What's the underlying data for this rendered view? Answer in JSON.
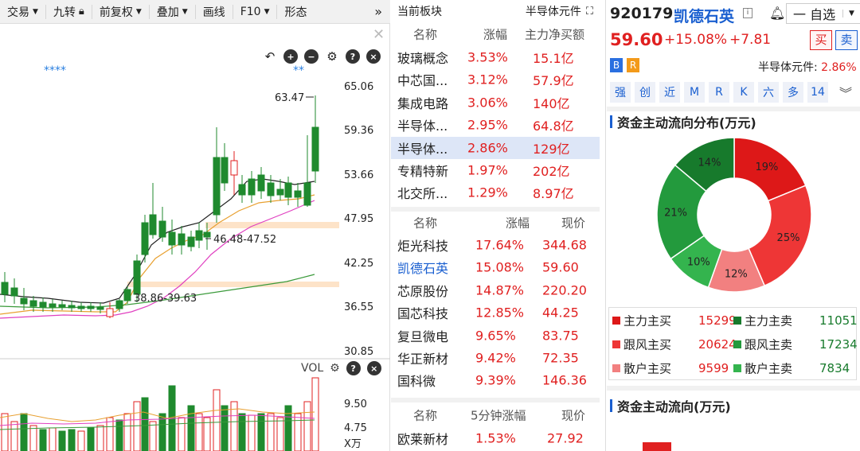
{
  "toolbar": {
    "items": [
      {
        "label": "交易",
        "caret": true
      },
      {
        "label": "九转",
        "icon": "lock-icon"
      },
      {
        "label": "前复权",
        "caret": true
      },
      {
        "label": "叠加",
        "caret": true
      },
      {
        "label": "画线"
      },
      {
        "label": "F10",
        "caret": true
      },
      {
        "label": "形态"
      }
    ]
  },
  "kline": {
    "price_labels": [
      "65.06",
      "59.36",
      "53.66",
      "47.95",
      "42.25",
      "36.55",
      "30.85"
    ],
    "annot_high": "63.47",
    "annot_zone_upper": "46.48-47.52",
    "annot_zone_lower": "38.86-39.63",
    "stars_left": "****",
    "stars_right": "**",
    "vol_label": "VOL",
    "vol_labels": [
      "9.50",
      "4.75",
      "X万"
    ]
  },
  "sector_panel": {
    "title": "当前板块",
    "current": "半导体元件",
    "headers": [
      "名称",
      "涨幅",
      "主力净买额"
    ],
    "rows": [
      {
        "name": "玻璃概念",
        "pct": "3.53%",
        "net": "15.1亿"
      },
      {
        "name": "中芯国...",
        "pct": "3.12%",
        "net": "57.9亿"
      },
      {
        "name": "集成电路",
        "pct": "3.06%",
        "net": "140亿"
      },
      {
        "name": "半导体...",
        "pct": "2.95%",
        "net": "64.8亿"
      },
      {
        "name": "半导体...",
        "pct": "2.86%",
        "net": "129亿"
      },
      {
        "name": "专精特新",
        "pct": "1.97%",
        "net": "202亿"
      },
      {
        "name": "北交所...",
        "pct": "1.29%",
        "net": "8.97亿"
      }
    ]
  },
  "stock_list": {
    "headers": [
      "名称",
      "涨幅",
      "现价"
    ],
    "rows": [
      {
        "name": "炬光科技",
        "pct": "17.64%",
        "price": "344.68"
      },
      {
        "name": "凯德石英",
        "pct": "15.08%",
        "price": "59.60"
      },
      {
        "name": "芯原股份",
        "pct": "14.87%",
        "price": "220.20"
      },
      {
        "name": "国芯科技",
        "pct": "12.85%",
        "price": "44.25"
      },
      {
        "name": "复旦微电",
        "pct": "9.65%",
        "price": "83.75"
      },
      {
        "name": "华正新材",
        "pct": "9.42%",
        "price": "72.35"
      },
      {
        "name": "国科微",
        "pct": "9.39%",
        "price": "146.36"
      }
    ]
  },
  "speed_list": {
    "headers": [
      "名称",
      "5分钟涨幅",
      "现价"
    ],
    "rows": [
      {
        "name": "欧莱新材",
        "pct": "1.53%",
        "price": "27.92"
      }
    ]
  },
  "quote": {
    "code": "920179",
    "name": "凯德石英",
    "info_badge": "i",
    "watch_label": "一 自选",
    "price": "59.60",
    "pct": "+15.08%",
    "change": "+7.81",
    "buy": "买",
    "sell": "卖",
    "badge_b": "B",
    "badge_r": "R",
    "sector_line_name": "半导体元件:",
    "sector_line_pct": "2.86%",
    "buttons": [
      "强",
      "创",
      "近",
      "M",
      "R",
      "K",
      "六",
      "多",
      "14"
    ]
  },
  "fund_flow": {
    "dist_title": "资金主动流向分布(万元)",
    "donut": [
      {
        "label": "19%",
        "value": 19,
        "color": "#dd1818"
      },
      {
        "label": "25%",
        "value": 25,
        "color": "#ee3636"
      },
      {
        "label": "12%",
        "value": 12,
        "color": "#f28080"
      },
      {
        "label": "10%",
        "value": 10,
        "color": "#34b44e"
      },
      {
        "label": "21%",
        "value": 21,
        "color": "#239a3d"
      },
      {
        "label": "14%",
        "value": 14,
        "color": "#177a2c"
      }
    ],
    "legend": [
      {
        "buy_label": "主力主买",
        "buy_value": "15299",
        "buy_color": "#dd1818",
        "sell_label": "主力主卖",
        "sell_value": "11051",
        "sell_color": "#177a2c"
      },
      {
        "buy_label": "跟风主买",
        "buy_value": "20624",
        "buy_color": "#ee3636",
        "sell_label": "跟风主卖",
        "sell_value": "17234",
        "sell_color": "#239a3d"
      },
      {
        "buy_label": "散户主买",
        "buy_value": "9599",
        "buy_color": "#f28080",
        "sell_label": "散户主卖",
        "sell_value": "7834",
        "sell_color": "#34b44e"
      }
    ],
    "flow_title": "资金主动流向(万元)"
  }
}
